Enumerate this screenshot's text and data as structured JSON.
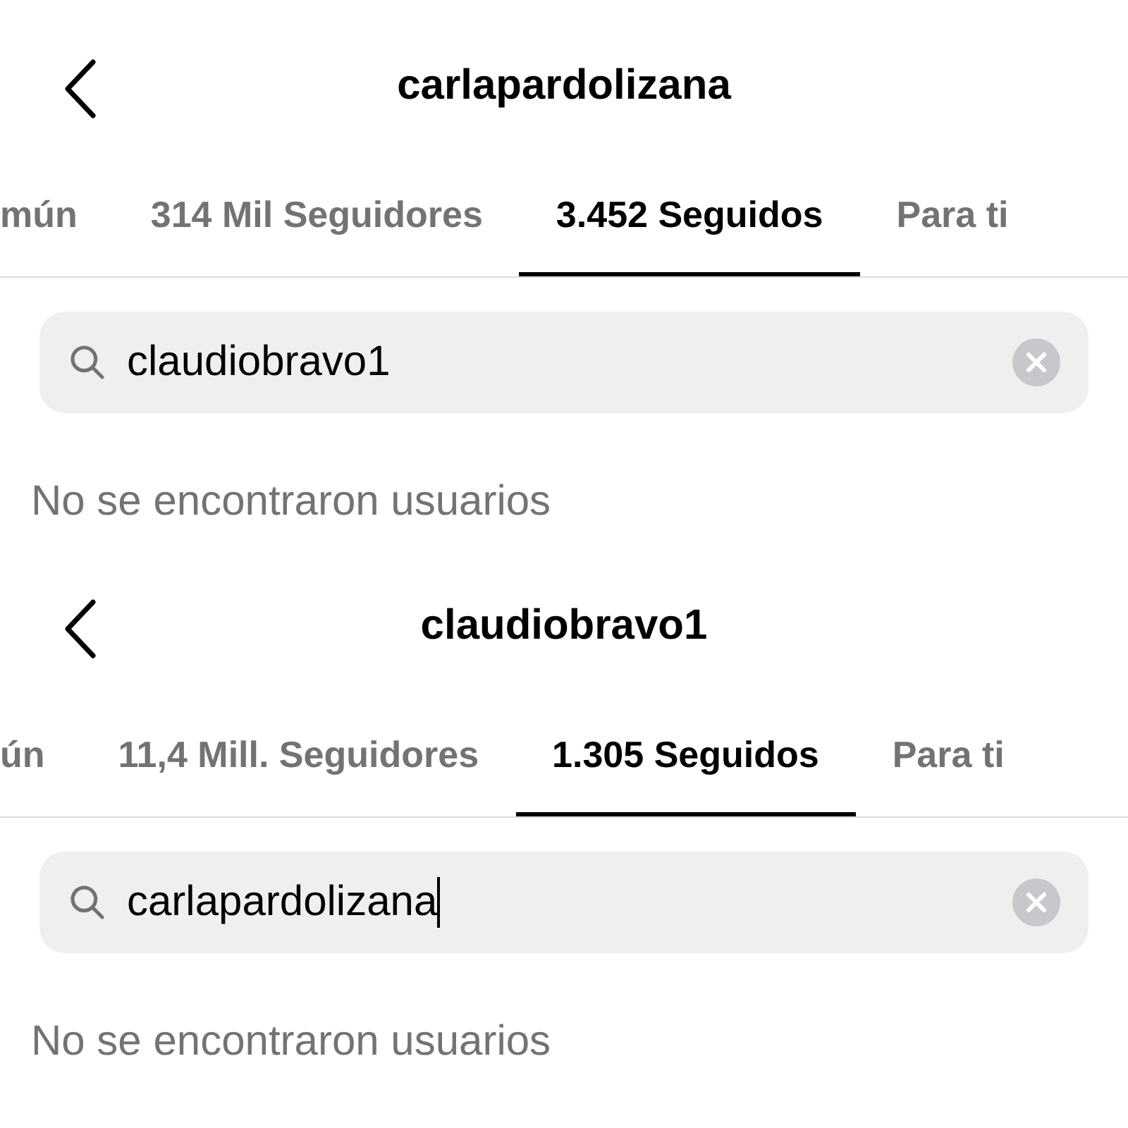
{
  "screens": [
    {
      "header": {
        "title": "carlapardolizana"
      },
      "tabs": [
        {
          "label": "mún",
          "selected": false
        },
        {
          "label": "314 Mil Seguidores",
          "selected": false
        },
        {
          "label": "3.452 Seguidos",
          "selected": true
        },
        {
          "label": "Para ti",
          "selected": false
        }
      ],
      "search": {
        "value": "claudiobravo1",
        "focused": false
      },
      "empty_message": "No se encontraron usuarios"
    },
    {
      "header": {
        "title": "claudiobravo1"
      },
      "tabs": [
        {
          "label": "ún",
          "selected": false
        },
        {
          "label": "11,4 Mill. Seguidores",
          "selected": false
        },
        {
          "label": "1.305 Seguidos",
          "selected": true
        },
        {
          "label": "Para ti",
          "selected": false
        }
      ],
      "search": {
        "value": "carlapardolizana",
        "focused": true
      },
      "empty_message": "No se encontraron usuarios"
    }
  ]
}
